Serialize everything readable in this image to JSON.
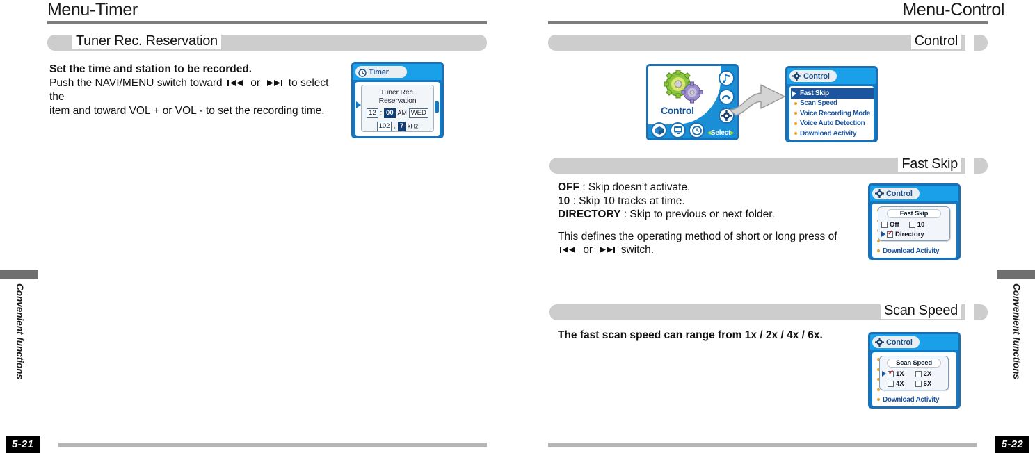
{
  "left_page": {
    "title": "Menu-Timer",
    "page_number": "5-21",
    "side_tab": "Convenient functions",
    "section": {
      "label": "Tuner Rec. Reservation"
    },
    "body": {
      "heading": "Set the time and station to be recorded.",
      "line1_a": "Push the NAVI/MENU switch toward",
      "line1_or": "or",
      "line1_b": "to select the",
      "line2": "item and toward VOL + or VOL - to set the recording time."
    },
    "lcd": {
      "header_title": "Timer",
      "header_icon": "clock-icon",
      "menu_line": "Tuner Rec. Reservation",
      "hour": "12",
      "separator": ":",
      "minute": "00",
      "meridiem": "AM",
      "weekday": "WED",
      "freq_int": "102",
      "freq_dot": ".",
      "freq_dec": "7",
      "freq_unit": "kHz"
    }
  },
  "right_page": {
    "title": "Menu-Control",
    "page_number": "5-22",
    "side_tab": "Convenient functions",
    "sections": {
      "control": "Control",
      "fast_skip": "Fast Skip",
      "scan_speed": "Scan Speed"
    },
    "control_graphic": {
      "label": "Control",
      "select_text": "Select",
      "icons": [
        "note-icon",
        "repeat-icon",
        "gear-icon",
        "box-icon",
        "display-icon",
        "clock-icon"
      ]
    },
    "control_list": {
      "header_title": "Control",
      "header_icon": "gear-icon",
      "items": [
        {
          "label": "Fast Skip",
          "selected": true
        },
        {
          "label": "Scan Speed",
          "selected": false
        },
        {
          "label": "Voice Recording Mode",
          "selected": false
        },
        {
          "label": "Voice Auto Detection",
          "selected": false
        },
        {
          "label": "Download Activity",
          "selected": false
        }
      ]
    },
    "fast_skip": {
      "text": {
        "l1_b": "OFF",
        "l1_r": ": Skip doesn’t  activate.",
        "l2_b": "10",
        "l2_r": ": Skip 10 tracks at time.",
        "l3_b": "DIRECTORY",
        "l3_r": ": Skip to previous or next folder.",
        "l4": "This defines the operating method of short or long press of",
        "l5_or": "or",
        "l5_end": "switch."
      },
      "lcd": {
        "header_title": "Control",
        "popup_title": "Fast Skip",
        "options": [
          {
            "label": "Off",
            "checked": false,
            "cursor": false
          },
          {
            "label": "10",
            "checked": false,
            "cursor": false
          },
          {
            "label": "Directory",
            "checked": true,
            "cursor": true
          }
        ],
        "bottom_item": "Download Activity"
      }
    },
    "scan_speed": {
      "text": "The fast scan speed can range from 1x / 2x / 4x / 6x.",
      "lcd": {
        "header_title": "Control",
        "popup_title": "Scan Speed",
        "options": [
          {
            "label": "1X",
            "checked": true,
            "cursor": true
          },
          {
            "label": "2X",
            "checked": false,
            "cursor": false
          },
          {
            "label": "4X",
            "checked": false,
            "cursor": false
          },
          {
            "label": "6X",
            "checked": false,
            "cursor": false
          }
        ],
        "bottom_item": "Download Activity"
      }
    }
  },
  "colors": {
    "bar_gray": "#cdcdcd",
    "rule_gray": "#7d7d7d",
    "lcd_blue": "#1479c4",
    "lcd_header": "#19a0e8",
    "select_blue": "#1b55a0",
    "accent_orange": "#f0a21e"
  }
}
